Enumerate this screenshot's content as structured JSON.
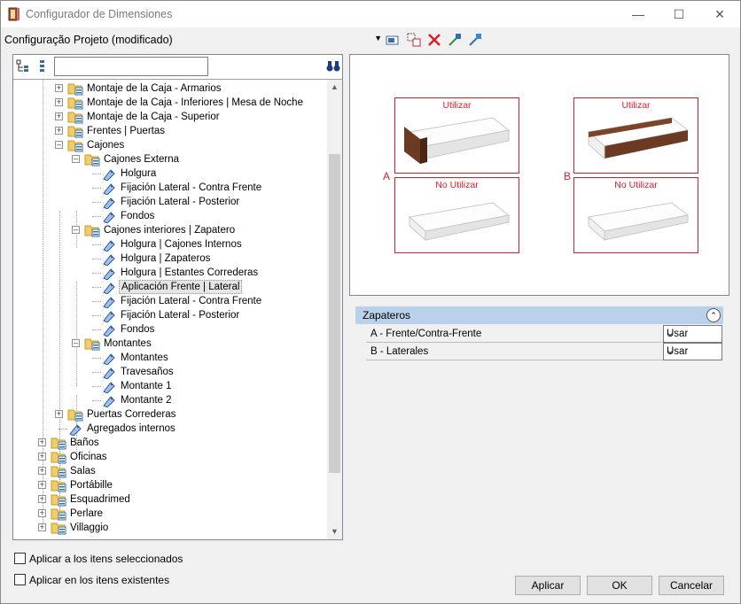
{
  "window": {
    "title": "Configurador de Dimensiones"
  },
  "toolbar": {
    "config": "Configuração Projeto (modificado)"
  },
  "tree": {
    "nodes": [
      {
        "label": "Montaje de la Caja - Armarios"
      },
      {
        "label": "Montaje de la Caja - Inferiores | Mesa de Noche"
      },
      {
        "label": "Montaje de la Caja - Superior"
      },
      {
        "label": "Frentes | Puertas"
      },
      {
        "label": "Cajones"
      },
      {
        "label": "Cajones Externa"
      },
      {
        "label": "Holgura"
      },
      {
        "label": "Fijación Lateral - Contra Frente"
      },
      {
        "label": "Fijación Lateral - Posterior"
      },
      {
        "label": "Fondos"
      },
      {
        "label": "Cajones interiores | Zapatero"
      },
      {
        "label": "Holgura | Cajones Internos"
      },
      {
        "label": "Holgura | Zapateros"
      },
      {
        "label": "Holgura | Estantes Correderas"
      },
      {
        "label": "Aplicación Frente | Lateral"
      },
      {
        "label": "Fijación Lateral - Contra Frente"
      },
      {
        "label": "Fijación Lateral - Posterior"
      },
      {
        "label": "Fondos"
      },
      {
        "label": "Montantes"
      },
      {
        "label": "Montantes"
      },
      {
        "label": "Travesaños"
      },
      {
        "label": "Montante 1"
      },
      {
        "label": "Montante 2"
      },
      {
        "label": "Puertas Correderas"
      },
      {
        "label": "Agregados internos"
      },
      {
        "label": "Baños"
      },
      {
        "label": "Oficinas"
      },
      {
        "label": "Salas"
      },
      {
        "label": "Portábille"
      },
      {
        "label": "Esquadrimed"
      },
      {
        "label": "Perlare"
      },
      {
        "label": "Villaggio"
      }
    ]
  },
  "preview": {
    "letter_a": "A",
    "letter_b": "B",
    "use": "Utilizar",
    "no_use": "No Utilizar"
  },
  "properties": {
    "section": "Zapateros",
    "rows": [
      {
        "key": "A -  Frente/Contra-Frente",
        "value": "Usar"
      },
      {
        "key": "B -  Laterales",
        "value": "Usar"
      }
    ]
  },
  "footer": {
    "apply_selected": "Aplicar a los itens seleccionados",
    "apply_existing": "Aplicar en los itens existentes",
    "apply_button": "Aplicar",
    "ok_button": "OK",
    "cancel_button": "Cancelar"
  },
  "colors": {
    "accent_red": "#d9202a",
    "section_blue": "#b9d1ea",
    "wood": "#6b3a22"
  }
}
